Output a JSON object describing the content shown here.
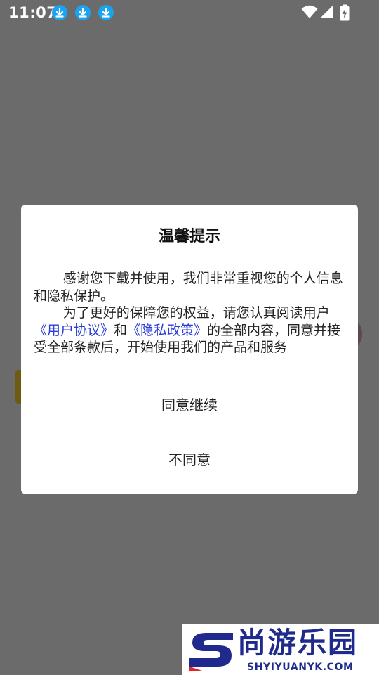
{
  "status_bar": {
    "time": "11:07",
    "notification_icons": [
      "download-icon",
      "download-icon",
      "download-icon"
    ],
    "right_icons": [
      "wifi-icon",
      "signal-icon",
      "battery-charging-icon"
    ]
  },
  "dialog": {
    "title": "温馨提示",
    "paragraph1": "感谢您下载并使用，我们非常重视您的个人信息和隐私保护。",
    "paragraph2_prefix": "为了更好的保障您的权益，请您认真阅读用户",
    "link_user_agreement": "《用户协议》",
    "paragraph2_and": "和",
    "link_privacy_policy": "《隐私政策》",
    "paragraph2_suffix": "的全部内容，同意并接受全部条款后，开始使用我们的产品和服务",
    "agree_button": "同意继续",
    "disagree_button": "不同意"
  },
  "watermark": {
    "brand": "尚游乐园",
    "domain": "SHYIYUANYK.COM"
  },
  "colors": {
    "overlay": "#6b6b6b",
    "link": "#2a3dd6",
    "notification_blue": "#1aa3f0",
    "watermark_blue": "#1f2a8c"
  }
}
